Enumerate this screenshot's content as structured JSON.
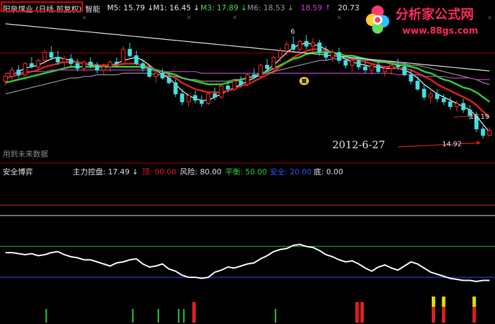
{
  "header": {
    "stock_name": "阳泉煤业",
    "chart_mode": "(日线,前复权)",
    "mode_suffix": "智能",
    "ma": [
      {
        "label": "M5: 15.79",
        "arrow": "↓",
        "color": "#e8e8e8"
      },
      {
        "label": "M1: 16.45",
        "arrow": "↓",
        "color": "#e8e8e8"
      },
      {
        "label": "M3: 17.89",
        "arrow": "↓",
        "color": "#44e044"
      },
      {
        "label": "M6: 18.53",
        "arrow": "↓",
        "color": "#9a9a9a"
      },
      {
        "label": "18.59",
        "arrow": "↑",
        "color": "#d040d0"
      },
      {
        "label": "20.73",
        "arrow": "",
        "color": "#e8e8e8"
      }
    ]
  },
  "logo": {
    "title": "分析家公式网",
    "url": "www.88gs.com"
  },
  "chart_data": [
    {
      "type": "candlestick",
      "panel": "price",
      "annotations": {
        "date": "2012-6-27",
        "low_price": "14.92",
        "right_price": "16.19",
        "future_note": "用到未来数据",
        "peak_label": "6"
      },
      "price_range": [
        13.8,
        22.2
      ],
      "candles": [
        [
          18.4,
          18.9,
          18.1,
          18.7
        ],
        [
          18.7,
          19.3,
          18.5,
          19.1
        ],
        [
          19.1,
          19.4,
          18.6,
          18.8
        ],
        [
          18.8,
          19.6,
          18.7,
          19.5
        ],
        [
          19.5,
          19.9,
          19.2,
          19.3
        ],
        [
          19.3,
          19.8,
          19.1,
          19.7
        ],
        [
          19.7,
          20.4,
          19.5,
          20.2
        ],
        [
          20.2,
          20.6,
          19.7,
          19.9
        ],
        [
          19.9,
          20.3,
          19.4,
          19.6
        ],
        [
          19.6,
          20.0,
          19.2,
          19.8
        ],
        [
          19.8,
          20.1,
          19.3,
          19.5
        ],
        [
          19.5,
          19.8,
          19.0,
          19.2
        ],
        [
          19.2,
          19.7,
          19.0,
          19.6
        ],
        [
          19.6,
          19.9,
          19.2,
          19.4
        ],
        [
          19.4,
          19.6,
          18.9,
          19.1
        ],
        [
          19.1,
          19.5,
          18.8,
          19.3
        ],
        [
          19.3,
          19.7,
          19.0,
          19.6
        ],
        [
          19.6,
          19.9,
          19.3,
          19.5
        ],
        [
          19.5,
          20.6,
          19.4,
          20.4
        ],
        [
          20.4,
          20.8,
          19.9,
          20.0
        ],
        [
          20.0,
          20.3,
          19.4,
          19.5
        ],
        [
          19.5,
          19.8,
          19.0,
          19.2
        ],
        [
          19.2,
          19.4,
          18.6,
          18.7
        ],
        [
          18.7,
          19.0,
          18.3,
          18.9
        ],
        [
          18.9,
          19.2,
          18.5,
          18.6
        ],
        [
          18.6,
          18.9,
          18.2,
          18.3
        ],
        [
          18.3,
          18.5,
          17.4,
          17.6
        ],
        [
          17.6,
          17.9,
          16.9,
          17.1
        ],
        [
          17.1,
          17.6,
          16.8,
          17.5
        ],
        [
          17.5,
          17.8,
          17.0,
          17.2
        ],
        [
          17.2,
          17.5,
          16.8,
          17.0
        ],
        [
          17.0,
          17.7,
          16.9,
          17.6
        ],
        [
          17.6,
          18.0,
          17.2,
          17.4
        ],
        [
          17.4,
          18.2,
          17.3,
          18.1
        ],
        [
          18.1,
          18.4,
          17.7,
          17.9
        ],
        [
          17.9,
          18.5,
          17.8,
          18.4
        ],
        [
          18.4,
          18.7,
          18.0,
          18.2
        ],
        [
          18.2,
          18.9,
          18.1,
          18.8
        ],
        [
          18.8,
          19.2,
          18.5,
          18.7
        ],
        [
          18.7,
          19.5,
          18.6,
          19.4
        ],
        [
          19.4,
          19.8,
          19.0,
          19.2
        ],
        [
          19.2,
          20.0,
          19.1,
          19.9
        ],
        [
          19.9,
          20.5,
          19.6,
          20.3
        ],
        [
          20.3,
          20.9,
          20.0,
          20.7
        ],
        [
          20.7,
          21.2,
          20.2,
          20.4
        ],
        [
          20.4,
          21.0,
          20.1,
          20.9
        ],
        [
          20.9,
          21.3,
          20.4,
          20.6
        ],
        [
          20.6,
          21.1,
          20.2,
          20.8
        ],
        [
          20.8,
          21.0,
          20.0,
          20.2
        ],
        [
          20.2,
          20.6,
          19.7,
          19.9
        ],
        [
          19.9,
          20.4,
          19.6,
          20.2
        ],
        [
          20.2,
          20.5,
          19.5,
          19.7
        ],
        [
          19.7,
          20.0,
          19.2,
          19.4
        ],
        [
          19.4,
          19.8,
          19.0,
          19.7
        ],
        [
          19.7,
          19.9,
          19.1,
          19.3
        ],
        [
          19.3,
          19.6,
          18.9,
          19.1
        ],
        [
          19.1,
          19.5,
          18.8,
          19.4
        ],
        [
          19.4,
          19.7,
          18.9,
          19.0
        ],
        [
          19.0,
          19.3,
          18.7,
          19.2
        ],
        [
          19.2,
          19.6,
          18.8,
          19.4
        ],
        [
          19.4,
          19.8,
          19.1,
          19.3
        ],
        [
          19.3,
          19.6,
          18.7,
          18.8
        ],
        [
          18.8,
          19.1,
          18.2,
          18.4
        ],
        [
          18.4,
          18.7,
          17.8,
          17.9
        ],
        [
          17.9,
          18.2,
          17.2,
          17.4
        ],
        [
          17.4,
          17.8,
          17.0,
          17.6
        ],
        [
          17.6,
          17.9,
          17.1,
          17.3
        ],
        [
          17.3,
          17.6,
          16.9,
          17.1
        ],
        [
          17.1,
          17.4,
          16.6,
          16.8
        ],
        [
          16.8,
          17.2,
          16.5,
          17.0
        ],
        [
          17.0,
          17.3,
          16.4,
          16.6
        ],
        [
          16.6,
          16.9,
          16.0,
          16.2
        ],
        [
          16.2,
          16.5,
          15.2,
          15.4
        ],
        [
          15.4,
          15.6,
          14.8,
          15.0
        ],
        [
          15.0,
          15.5,
          14.9,
          15.3
        ]
      ],
      "ma_lines": [
        {
          "name": "white_short",
          "color": "#ffffff",
          "values": [
            18.5,
            18.8,
            19.0,
            19.2,
            19.3,
            19.4,
            19.6,
            19.8,
            19.9,
            19.8,
            19.7,
            19.6,
            19.5,
            19.4,
            19.3,
            19.3,
            19.4,
            19.5,
            19.7,
            19.8,
            19.9,
            19.7,
            19.4,
            19.1,
            18.8,
            18.6,
            18.2,
            17.8,
            17.5,
            17.3,
            17.2,
            17.2,
            17.4,
            17.6,
            17.8,
            18.0,
            18.2,
            18.4,
            18.6,
            18.8,
            19.1,
            19.4,
            19.8,
            20.2,
            20.5,
            20.7,
            20.8,
            20.7,
            20.6,
            20.4,
            20.2,
            20.0,
            19.8,
            19.6,
            19.5,
            19.4,
            19.3,
            19.3,
            19.2,
            19.2,
            19.2,
            19.1,
            18.9,
            18.6,
            18.2,
            17.9,
            17.6,
            17.4,
            17.2,
            17.0,
            16.8,
            16.6,
            16.2,
            15.7,
            15.2
          ]
        },
        {
          "name": "red",
          "color": "#e02020",
          "values": [
            18.6,
            18.7,
            18.8,
            18.9,
            19.0,
            19.1,
            19.3,
            19.4,
            19.5,
            19.6,
            19.6,
            19.6,
            19.5,
            19.5,
            19.4,
            19.4,
            19.4,
            19.4,
            19.5,
            19.5,
            19.5,
            19.4,
            19.3,
            19.1,
            19.0,
            18.8,
            18.6,
            18.3,
            18.1,
            17.9,
            17.8,
            17.7,
            17.7,
            17.7,
            17.8,
            17.9,
            18.1,
            18.2,
            18.4,
            18.6,
            18.8,
            19.0,
            19.3,
            19.6,
            19.9,
            20.1,
            20.3,
            20.4,
            20.4,
            20.3,
            20.2,
            20.1,
            20.0,
            19.8,
            19.7,
            19.6,
            19.5,
            19.4,
            19.3,
            19.3,
            19.2,
            19.2,
            19.1,
            18.9,
            18.7,
            18.5,
            18.2,
            18.0,
            17.8,
            17.6,
            17.4,
            17.2,
            16.9,
            16.5,
            16.1
          ]
        },
        {
          "name": "green",
          "color": "#30d030",
          "values": [
            18.3,
            18.4,
            18.5,
            18.6,
            18.7,
            18.8,
            18.9,
            19.0,
            19.1,
            19.2,
            19.3,
            19.3,
            19.3,
            19.3,
            19.3,
            19.3,
            19.3,
            19.3,
            19.3,
            19.3,
            19.3,
            19.3,
            19.2,
            19.1,
            19.0,
            18.9,
            18.8,
            18.6,
            18.5,
            18.4,
            18.3,
            18.2,
            18.2,
            18.2,
            18.3,
            18.4,
            18.5,
            18.6,
            18.7,
            18.9,
            19.0,
            19.2,
            19.4,
            19.6,
            19.8,
            19.9,
            20.1,
            20.2,
            20.2,
            20.2,
            20.2,
            20.1,
            20.0,
            20.0,
            19.9,
            19.8,
            19.7,
            19.6,
            19.6,
            19.5,
            19.4,
            19.4,
            19.3,
            19.2,
            19.0,
            18.9,
            18.7,
            18.5,
            18.4,
            18.2,
            18.0,
            17.9,
            17.7,
            17.4,
            17.1
          ]
        },
        {
          "name": "gray_long",
          "color": "#9a9a9a",
          "values": [
            17.6,
            17.7,
            17.8,
            17.9,
            18.0,
            18.1,
            18.2,
            18.3,
            18.4,
            18.5,
            18.6,
            18.6,
            18.7,
            18.7,
            18.8,
            18.8,
            18.8,
            18.8,
            18.9,
            18.9,
            18.9,
            18.9,
            18.9,
            18.8,
            18.8,
            18.7,
            18.7,
            18.6,
            18.5,
            18.5,
            18.4,
            18.4,
            18.4,
            18.4,
            18.4,
            18.5,
            18.5,
            18.6,
            18.7,
            18.8,
            18.9,
            19.0,
            19.1,
            19.2,
            19.3,
            19.4,
            19.5,
            19.6,
            19.7,
            19.7,
            19.8,
            19.8,
            19.8,
            19.8,
            19.8,
            19.7,
            19.7,
            19.7,
            19.6,
            19.6,
            19.5,
            19.5,
            19.4,
            19.4,
            19.3,
            19.2,
            19.1,
            19.0,
            18.9,
            18.8,
            18.7,
            18.6,
            18.5,
            18.3,
            18.2
          ]
        },
        {
          "name": "magenta",
          "color": "#c040c0",
          "values": [
            18.9,
            18.9,
            18.9,
            19.0,
            19.0,
            19.0,
            19.0,
            19.1,
            19.1,
            19.1,
            19.1,
            19.1,
            19.1,
            19.1,
            19.1,
            19.1,
            19.1,
            19.1,
            19.1,
            19.1,
            19.1,
            19.1,
            19.1,
            19.0,
            19.0,
            19.0,
            19.0,
            19.0,
            19.0,
            19.0,
            18.9,
            18.9,
            18.9,
            18.9,
            18.9,
            18.9,
            18.9,
            18.9,
            18.9,
            18.9,
            18.9,
            18.9,
            18.9,
            18.9,
            18.9,
            18.9,
            18.9,
            18.9,
            18.9,
            18.9,
            18.9,
            18.9,
            18.9,
            18.9,
            18.9,
            18.9,
            18.9,
            18.9,
            18.9,
            18.9,
            18.8,
            18.8,
            18.8,
            18.8,
            18.7,
            18.7,
            18.7,
            18.7,
            18.6,
            18.6,
            18.6,
            18.6,
            18.5,
            18.5,
            18.5
          ]
        },
        {
          "name": "white_trend",
          "color": "#e6e6e6",
          "values": [
            22.0,
            21.96,
            21.92,
            21.88,
            21.84,
            21.8,
            21.76,
            21.72,
            21.68,
            21.64,
            21.6,
            21.56,
            21.52,
            21.48,
            21.44,
            21.4,
            21.36,
            21.32,
            21.28,
            21.24,
            21.2,
            21.16,
            21.12,
            21.08,
            21.04,
            21.0,
            20.96,
            20.92,
            20.88,
            20.84,
            20.8,
            20.76,
            20.72,
            20.68,
            20.64,
            20.6,
            20.56,
            20.52,
            20.48,
            20.44,
            20.4,
            20.36,
            20.32,
            20.28,
            20.24,
            20.2,
            20.16,
            20.12,
            20.08,
            20.04,
            20.0,
            19.96,
            19.92,
            19.88,
            19.84,
            19.8,
            19.76,
            19.72,
            19.68,
            19.64,
            19.6,
            19.56,
            19.52,
            19.48,
            19.44,
            19.4,
            19.36,
            19.32,
            19.28,
            19.24,
            19.2,
            19.16,
            19.12,
            19.08,
            19.04
          ]
        }
      ]
    },
    {
      "type": "line",
      "panel": "indicator",
      "title": "安全博弈",
      "legend": [
        {
          "label": "主力控盘: 17.49",
          "arrow": "↓",
          "color": "#e0e0e0"
        },
        {
          "label": "顶: 90.00",
          "color": "#e02020"
        },
        {
          "label": "风险: 80.00",
          "color": "#e0e0e0"
        },
        {
          "label": "平衡: 50.00",
          "color": "#30d030"
        },
        {
          "label": "安全: 20.00",
          "color": "#3050ff"
        },
        {
          "label": "底: 0.00",
          "color": "#e0e0e0"
        }
      ],
      "ylim": [
        0,
        100
      ],
      "levels": [
        {
          "name": "顶",
          "value": 90,
          "color": "#e02020"
        },
        {
          "name": "风险",
          "value": 80,
          "color": "#e0e0e0"
        },
        {
          "name": "平衡",
          "value": 50,
          "color": "#30d030"
        },
        {
          "name": "安全",
          "value": 20,
          "color": "#3050ff"
        }
      ],
      "series": [
        {
          "name": "主力控盘",
          "color": "#ffffff",
          "values": [
            44,
            44,
            43,
            42,
            43,
            41,
            42,
            44,
            45,
            42,
            40,
            39,
            37,
            37,
            35,
            33,
            31,
            34,
            35,
            37,
            38,
            33,
            30,
            31,
            33,
            28,
            26,
            22,
            20,
            20,
            19,
            20,
            25,
            27,
            30,
            29,
            31,
            33,
            34,
            38,
            41,
            45,
            47,
            48,
            51,
            52,
            50,
            49,
            46,
            42,
            40,
            37,
            35,
            36,
            33,
            29,
            26,
            30,
            32,
            29,
            27,
            31,
            35,
            33,
            29,
            25,
            23,
            21,
            19,
            18,
            17,
            17,
            16,
            17,
            17
          ]
        }
      ],
      "signals": [
        {
          "index": 8,
          "color": "#30d030",
          "strength": 0.5
        },
        {
          "index": 25,
          "color": "#30d030",
          "strength": 0.5
        },
        {
          "index": 30,
          "color": "#30d030",
          "strength": 0.5
        },
        {
          "index": 34,
          "color": "#30d030",
          "strength": 0.5
        },
        {
          "index": 35,
          "color": "#30d030",
          "strength": 0.5
        },
        {
          "index": 37,
          "color": "#e02020",
          "strength": 1
        },
        {
          "index": 53,
          "color": "#30d030",
          "strength": 0.5
        },
        {
          "index": 69,
          "color": "#e02020",
          "strength": 1
        },
        {
          "index": 70,
          "color": "#e02020",
          "strength": 1
        },
        {
          "index": 84,
          "color": "#e0e000",
          "strength": 1.4
        },
        {
          "index": 86,
          "color": "#e0e000",
          "strength": 1.4
        },
        {
          "index": 92,
          "color": "#e0e000",
          "strength": 1.4
        }
      ]
    }
  ]
}
